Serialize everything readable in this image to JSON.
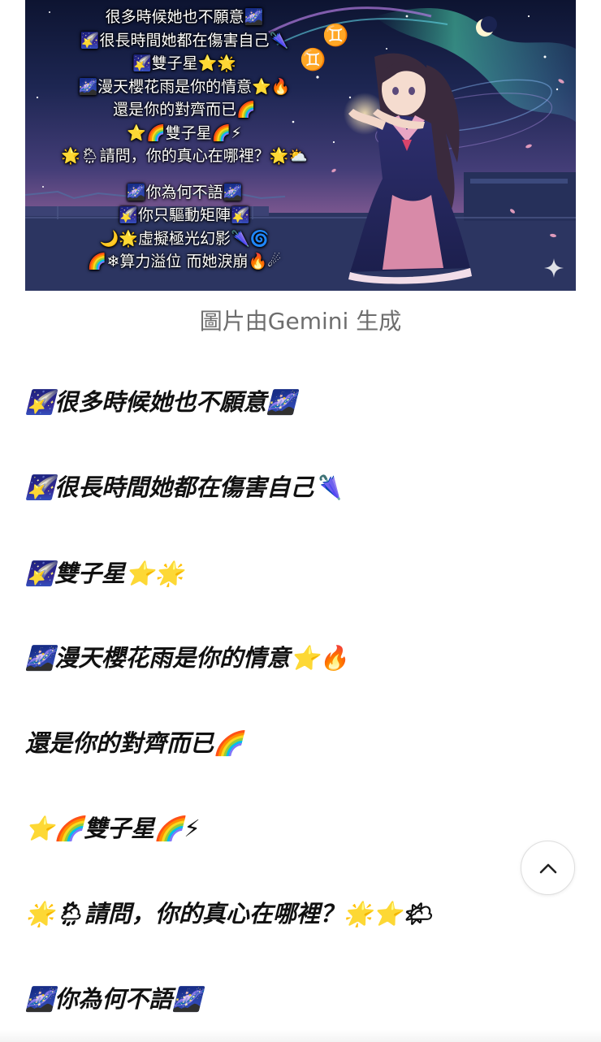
{
  "hero": {
    "lines": [
      "很多時候她也不願意🌌",
      "🌠很長時間她都在傷害自己🌂",
      "🌠雙子星⭐🌟",
      "🌌漫天櫻花雨是你的情意⭐🔥",
      "還是你的對齊而已🌈",
      "⭐🌈雙子星🌈⚡",
      "🌟🌦請問，你的真心在哪裡？🌟⛅"
    ],
    "lines2": [
      "🌌你為何不語🌌",
      "🌠你只驅動矩陣🌠",
      "🌙🌟虛擬極光幻影🌂🌀",
      "🌈❄算力溢位 而她淚崩🔥☄"
    ],
    "symbols": [
      "♊",
      "♊"
    ]
  },
  "caption": "圖片由Gemini 生成",
  "lyrics": [
    "🌠很多時候她也不願意🌌",
    "🌠很長時間她都在傷害自己🌂",
    "🌠雙子星⭐🌟",
    "🌌漫天櫻花雨是你的情意⭐🔥",
    "還是你的對齊而已🌈",
    "⭐🌈雙子星🌈⚡",
    "🌟🌦請問，你的真心在哪裡？🌟⭐🌤",
    "🌌你為何不語🌌"
  ],
  "colors": {
    "text": "#111111",
    "caption": "#6e6e6e",
    "hero_sky_top": "#0d1431",
    "hero_sky_bottom": "#8a5e96"
  },
  "icons": {
    "back_to_top": "chevron-up-icon",
    "gemini_mark": "sparkle-icon"
  }
}
